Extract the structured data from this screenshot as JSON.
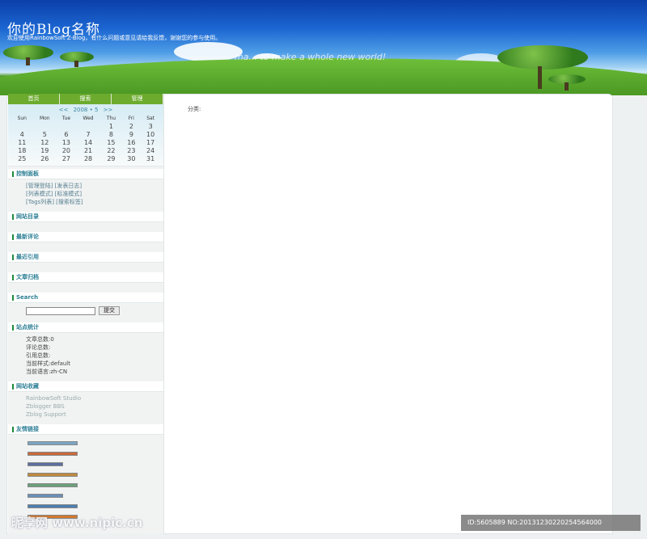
{
  "header": {
    "title": "你的Blog名称",
    "subtitle": "欢迎使用RainbowSoft Z-Blog，有什么问题或意见请给我反馈，谢谢您的参与使用。",
    "slogan": "ma... to make a whole new world!"
  },
  "nav": [
    "首页",
    "搜索",
    "管理"
  ],
  "calendar": {
    "caption_prev": "<<",
    "caption_month": "2008 • 5",
    "caption_next": ">>",
    "weekdays": [
      "Sun",
      "Mon",
      "Tue",
      "Wed",
      "Thu",
      "Fri",
      "Sat"
    ],
    "weeks": [
      [
        "",
        "",
        "",
        "",
        "1",
        "2",
        "3"
      ],
      [
        "4",
        "5",
        "6",
        "7",
        "8",
        "9",
        "10"
      ],
      [
        "11",
        "12",
        "13",
        "14",
        "15",
        "16",
        "17"
      ],
      [
        "18",
        "19",
        "20",
        "21",
        "22",
        "23",
        "24"
      ],
      [
        "25",
        "26",
        "27",
        "28",
        "29",
        "30",
        "31"
      ]
    ]
  },
  "control_panel": {
    "title": "控制面板",
    "rows": [
      "[管理登陆] [发表日志]",
      "[列表模式] [标准模式]",
      "[Tags列表] [搜索标签]"
    ]
  },
  "sections": {
    "catalog": "网站目录",
    "comments": "最新评论",
    "trackbacks": "最近引用",
    "archives": "文章归档",
    "search": "Search",
    "search_button": "提交",
    "stats": "站点统计",
    "favorites": "网站收藏",
    "links": "友情链接"
  },
  "stats": [
    "文章总数:0",
    "评论总数:",
    "引用总数:",
    "当前样式:default",
    "当前语言:zh-CN"
  ],
  "favorites": [
    "RainbowSoft Studio",
    "Zblogger BBS",
    "Zblog Support"
  ],
  "badge_colors": [
    "#7aa6c4",
    "#c96a3a",
    "#5b6fa0",
    "#c08a3e",
    "#6aa07a",
    "#6a8fb8",
    "#4d7fb0",
    "#d07a2e"
  ],
  "main": {
    "label": "分类:"
  },
  "watermark": {
    "left": "昵享网 www.nipic.cn",
    "right": "ID:5605889 NO:20131230220254564000"
  }
}
